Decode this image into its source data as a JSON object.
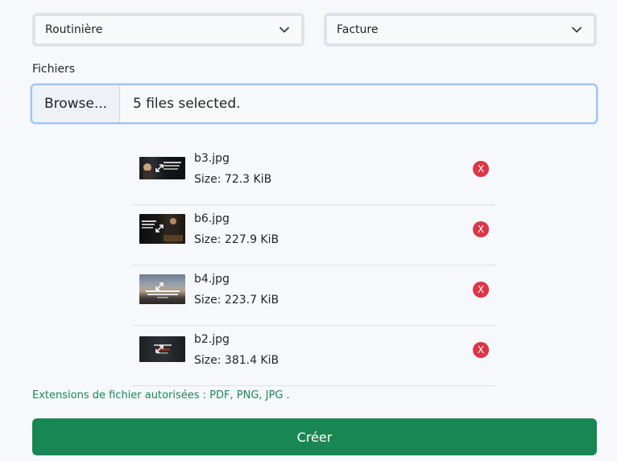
{
  "selects": [
    {
      "value": "Routinière",
      "icon": "chevron-down-icon"
    },
    {
      "value": "Facture",
      "icon": "chevron-down-icon"
    }
  ],
  "files_label": "Fichiers",
  "file_input": {
    "browse_label": "Browse...",
    "status": "5 files selected."
  },
  "files": [
    {
      "name": "b3.jpg",
      "size": "Size: 72.3 KiB",
      "remove": "X",
      "thumb_icon": "expand-icon"
    },
    {
      "name": "b6.jpg",
      "size": "Size: 227.9 KiB",
      "remove": "X",
      "thumb_icon": "expand-icon"
    },
    {
      "name": "b4.jpg",
      "size": "Size: 223.7 KiB",
      "remove": "X",
      "thumb_icon": "expand-icon"
    },
    {
      "name": "b2.jpg",
      "size": "Size: 381.4 KiB",
      "remove": "X",
      "thumb_icon": "expand-icon"
    }
  ],
  "hint": "Extensions de fichier autorisées : PDF, PNG, JPG .",
  "submit_label": "Créer",
  "colors": {
    "primary_green": "#198754",
    "danger_red": "#dc3545",
    "focus_border": "#9fc3f1"
  }
}
